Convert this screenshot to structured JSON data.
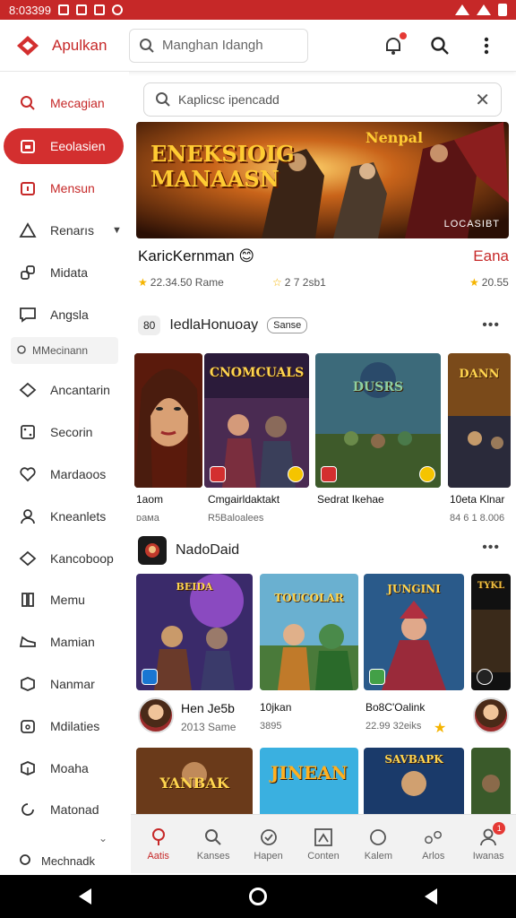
{
  "status_bar": {
    "time": "8:03399"
  },
  "app": {
    "title": "Apulkan",
    "top_search_placeholder": "Manghan Idangh"
  },
  "sidebar": {
    "items": [
      {
        "label": "Mecagian",
        "icon": "search-icon",
        "state": "red"
      },
      {
        "label": "Eeolasien",
        "icon": "store-icon",
        "state": "active"
      },
      {
        "label": "Mensun",
        "icon": "card-icon",
        "state": "red"
      },
      {
        "label": "Renarıs",
        "icon": "triangle-icon",
        "state": "expand"
      },
      {
        "label": "Midata",
        "icon": "apps-icon"
      },
      {
        "label": "Angsla",
        "icon": "chat-icon"
      }
    ],
    "section_label": "MMecinann",
    "items2": [
      {
        "label": "Ancantarin",
        "icon": "diamond-icon"
      },
      {
        "label": "Secorin",
        "icon": "grid-icon"
      },
      {
        "label": "Mardaoos",
        "icon": "heart-icon"
      },
      {
        "label": "Kneanlets",
        "icon": "person-icon"
      },
      {
        "label": "Kancoboop",
        "icon": "diamond-icon"
      },
      {
        "label": "Memu",
        "icon": "book-icon"
      },
      {
        "label": "Mamian",
        "icon": "shoe-icon"
      },
      {
        "label": "Nanmar",
        "icon": "cube-icon"
      },
      {
        "label": "Mdilaties",
        "icon": "controller-icon"
      },
      {
        "label": "Moaha",
        "icon": "box-icon"
      },
      {
        "label": "Matonad",
        "icon": "refresh-icon"
      }
    ],
    "bottom_label": "Mechnadk"
  },
  "main": {
    "search_placeholder": "Kaplicsc ipencadd",
    "banner": {
      "title_line1": "ENEKSIOIG",
      "title_line2": "MANAASN",
      "tag": "LOCASIBT",
      "corner_text": "Nenpal"
    },
    "featured": {
      "title": "KaricKernman 😊",
      "right_title": "Eana",
      "rating1": "22.34.50 Rame",
      "rating2": "2 7 2sb1",
      "rating3": "20.55"
    },
    "section1": {
      "chip": "80",
      "title": "IedlaHonuoay",
      "pill": "Sanse",
      "more": "•••"
    },
    "row1": [
      {
        "caption": "1aom",
        "sub": "ᴅaᴍa",
        "art": ""
      },
      {
        "caption": "Cmgairldaktakt",
        "sub": "R5Baloalees",
        "art": "CNOMCUALS"
      },
      {
        "caption": "Sedrat Ikehae",
        "sub": "",
        "art": "DUSRS"
      },
      {
        "caption": "10eta Klnar",
        "sub": "84 6 1 8.006",
        "art": "DANN"
      }
    ],
    "section2": {
      "title": "NadoDaid",
      "more": "•••"
    },
    "row2": [
      {
        "caption": "Hen Je5b",
        "sub": "2013 Same",
        "art": "BEIDA"
      },
      {
        "caption": "10jkan",
        "sub": "3895",
        "art": "TOUCOLAR"
      },
      {
        "caption": "Bo8C'Oalink",
        "sub": "22.99 32eiks",
        "art": "JUNGINI"
      },
      {
        "caption": "",
        "sub": "",
        "art": "TYKL"
      }
    ],
    "row3": [
      {
        "art": "YANBAK"
      },
      {
        "art": "JINEAN"
      },
      {
        "art": "SAVBAPK"
      },
      {
        "art": ""
      }
    ]
  },
  "bottom_nav": [
    {
      "label": "Aatis",
      "icon": "pin-icon",
      "active": true
    },
    {
      "label": "Kanses",
      "icon": "search-icon"
    },
    {
      "label": "Hapen",
      "icon": "shield-icon"
    },
    {
      "label": "Conten",
      "icon": "frame-icon"
    },
    {
      "label": "Kalem",
      "icon": "circle-icon"
    },
    {
      "label": "Arlos",
      "icon": "dots-icon"
    },
    {
      "label": "Iwanas",
      "icon": "person-icon",
      "badge": "1"
    }
  ],
  "colors": {
    "accent": "#d32f2f",
    "status_bar": "#c62828"
  }
}
